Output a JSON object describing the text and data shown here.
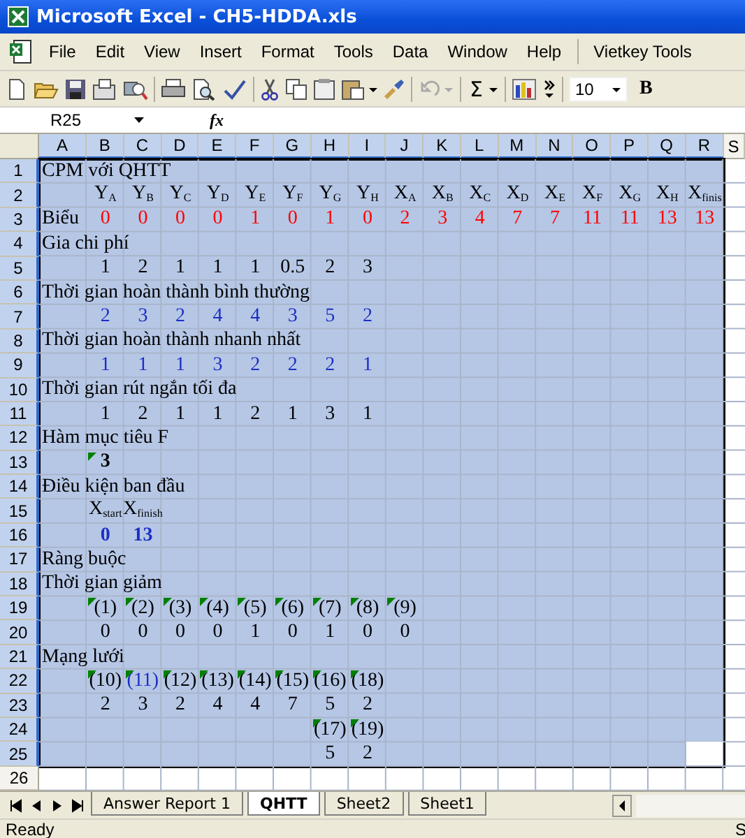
{
  "window": {
    "title": "Microsoft Excel - CH5-HDDA.xls"
  },
  "menu": [
    "File",
    "Edit",
    "View",
    "Insert",
    "Format",
    "Tools",
    "Data",
    "Window",
    "Help",
    "Vietkey Tools"
  ],
  "toolbar": {
    "sum_label": "Σ",
    "font_size": "10",
    "bold_label": "B"
  },
  "formula_bar": {
    "name_box": "R25",
    "function_label": "fx"
  },
  "sheet": {
    "columns": [
      {
        "label": "A",
        "selected": true
      },
      {
        "label": "B",
        "selected": true
      },
      {
        "label": "C",
        "selected": true
      },
      {
        "label": "D",
        "selected": true
      },
      {
        "label": "E",
        "selected": true
      },
      {
        "label": "F",
        "selected": true
      },
      {
        "label": "G",
        "selected": true
      },
      {
        "label": "H",
        "selected": true
      },
      {
        "label": "I",
        "selected": true
      },
      {
        "label": "J",
        "selected": true
      },
      {
        "label": "K",
        "selected": true
      },
      {
        "label": "L",
        "selected": true
      },
      {
        "label": "M",
        "selected": true
      },
      {
        "label": "N",
        "selected": true
      },
      {
        "label": "O",
        "selected": true
      },
      {
        "label": "P",
        "selected": true
      },
      {
        "label": "Q",
        "selected": true
      },
      {
        "label": "R",
        "selected": true
      },
      {
        "label": "S",
        "selected": false
      }
    ],
    "rows": [
      {
        "label": "1",
        "selected": true,
        "cells": [
          {
            "text": "CPM với QHTT"
          }
        ]
      },
      {
        "label": "2",
        "selected": true,
        "cells": [
          {},
          {
            "text": "Y$_{A}$"
          },
          {
            "text": "Y$_{B}$"
          },
          {
            "text": "Y$_{C}$"
          },
          {
            "text": "Y$_{D}$"
          },
          {
            "text": "Y$_{E}$"
          },
          {
            "text": "Y$_{F}$"
          },
          {
            "text": "Y$_{G}$"
          },
          {
            "text": "Y$_{H}$"
          },
          {
            "text": "X$_{A}$"
          },
          {
            "text": "X$_{B}$"
          },
          {
            "text": "X$_{C}$"
          },
          {
            "text": "X$_{D}$"
          },
          {
            "text": "X$_{E}$"
          },
          {
            "text": "X$_{F}$"
          },
          {
            "text": "X$_{G}$"
          },
          {
            "text": "X$_{H}$"
          },
          {
            "text": "X$_{finis}$"
          }
        ]
      },
      {
        "label": "3",
        "selected": true,
        "cells": [
          {
            "text": "Biểu"
          },
          {
            "text": "0",
            "color": "#ff0000"
          },
          {
            "text": "0",
            "color": "#ff0000"
          },
          {
            "text": "0",
            "color": "#ff0000"
          },
          {
            "text": "0",
            "color": "#ff0000"
          },
          {
            "text": "1",
            "color": "#ff0000"
          },
          {
            "text": "0",
            "color": "#ff0000"
          },
          {
            "text": "1",
            "color": "#ff0000"
          },
          {
            "text": "0",
            "color": "#ff0000"
          },
          {
            "text": "2",
            "color": "#ff0000"
          },
          {
            "text": "3",
            "color": "#ff0000"
          },
          {
            "text": "4",
            "color": "#ff0000"
          },
          {
            "text": "7",
            "color": "#ff0000"
          },
          {
            "text": "7",
            "color": "#ff0000"
          },
          {
            "text": "11",
            "color": "#ff0000"
          },
          {
            "text": "11",
            "color": "#ff0000"
          },
          {
            "text": "13",
            "color": "#ff0000"
          },
          {
            "text": "13",
            "color": "#ff0000"
          }
        ]
      },
      {
        "label": "4",
        "selected": true,
        "cells": [
          {
            "text": "Gia chi phí"
          }
        ]
      },
      {
        "label": "5",
        "selected": true,
        "cells": [
          {},
          {
            "text": "1"
          },
          {
            "text": "2"
          },
          {
            "text": "1"
          },
          {
            "text": "1"
          },
          {
            "text": "1"
          },
          {
            "text": "0.5"
          },
          {
            "text": "2"
          },
          {
            "text": "3"
          }
        ]
      },
      {
        "label": "6",
        "selected": true,
        "cells": [
          {
            "text": "Thời gian hoàn thành bình thường"
          }
        ]
      },
      {
        "label": "7",
        "selected": true,
        "cells": [
          {},
          {
            "text": "2",
            "color": "#1c2fc4"
          },
          {
            "text": "3",
            "color": "#1c2fc4"
          },
          {
            "text": "2",
            "color": "#1c2fc4"
          },
          {
            "text": "4",
            "color": "#1c2fc4"
          },
          {
            "text": "4",
            "color": "#1c2fc4"
          },
          {
            "text": "3",
            "color": "#1c2fc4"
          },
          {
            "text": "5",
            "color": "#1c2fc4"
          },
          {
            "text": "2",
            "color": "#1c2fc4"
          }
        ]
      },
      {
        "label": "8",
        "selected": true,
        "cells": [
          {
            "text": "Thời gian hoàn thành nhanh nhất"
          }
        ]
      },
      {
        "label": "9",
        "selected": true,
        "cells": [
          {},
          {
            "text": "1",
            "color": "#1c2fc4"
          },
          {
            "text": "1",
            "color": "#1c2fc4"
          },
          {
            "text": "1",
            "color": "#1c2fc4"
          },
          {
            "text": "3",
            "color": "#1c2fc4"
          },
          {
            "text": "2",
            "color": "#1c2fc4"
          },
          {
            "text": "2",
            "color": "#1c2fc4"
          },
          {
            "text": "2",
            "color": "#1c2fc4"
          },
          {
            "text": "1",
            "color": "#1c2fc4"
          }
        ]
      },
      {
        "label": "10",
        "selected": true,
        "cells": [
          {
            "text": "Thời gian rút ngắn tối đa"
          }
        ]
      },
      {
        "label": "11",
        "selected": true,
        "cells": [
          {},
          {
            "text": "1"
          },
          {
            "text": "2"
          },
          {
            "text": "1"
          },
          {
            "text": "1"
          },
          {
            "text": "2"
          },
          {
            "text": "1"
          },
          {
            "text": "3"
          },
          {
            "text": "1"
          }
        ]
      },
      {
        "label": "12",
        "selected": true,
        "cells": [
          {
            "text": "Hàm mục tiêu F"
          }
        ]
      },
      {
        "label": "13",
        "selected": true,
        "cells": [
          {},
          {
            "text": "3",
            "bold": true,
            "flagged": true
          }
        ]
      },
      {
        "label": "14",
        "selected": true,
        "cells": [
          {
            "text": "Điều kiện ban đầu"
          }
        ]
      },
      {
        "label": "15",
        "selected": true,
        "cells": [
          {},
          {
            "text": "X$_{start}$"
          },
          {
            "text": "X$_{finish}$"
          }
        ]
      },
      {
        "label": "16",
        "selected": true,
        "cells": [
          {},
          {
            "text": "0",
            "bold": true,
            "color": "#1c2fc4"
          },
          {
            "text": "13",
            "bold": true,
            "color": "#1c2fc4"
          }
        ]
      },
      {
        "label": "17",
        "selected": true,
        "cells": [
          {
            "text": "Ràng buộc"
          }
        ]
      },
      {
        "label": "18",
        "selected": true,
        "cells": [
          {
            "text": "Thời gian giảm"
          }
        ]
      },
      {
        "label": "19",
        "selected": true,
        "cells": [
          {},
          {
            "text": "(1)",
            "flagged": true
          },
          {
            "text": "(2)",
            "flagged": true
          },
          {
            "text": "(3)",
            "flagged": true
          },
          {
            "text": "(4)",
            "flagged": true
          },
          {
            "text": "(5)",
            "flagged": true
          },
          {
            "text": "(6)",
            "flagged": true
          },
          {
            "text": "(7)",
            "flagged": true
          },
          {
            "text": "(8)",
            "flagged": true
          },
          {
            "text": "(9)",
            "flagged": true
          }
        ]
      },
      {
        "label": "20",
        "selected": true,
        "cells": [
          {},
          {
            "text": "0"
          },
          {
            "text": "0"
          },
          {
            "text": "0"
          },
          {
            "text": "0"
          },
          {
            "text": "1"
          },
          {
            "text": "0"
          },
          {
            "text": "1"
          },
          {
            "text": "0"
          },
          {
            "text": "0"
          }
        ]
      },
      {
        "label": "21",
        "selected": true,
        "cells": [
          {
            "text": "Mạng lưới"
          }
        ]
      },
      {
        "label": "22",
        "selected": true,
        "cells": [
          {},
          {
            "text": "(10)",
            "flagged": true
          },
          {
            "text": "(11)",
            "flagged": true,
            "color": "#1c2fc4"
          },
          {
            "text": "(12)",
            "flagged": true
          },
          {
            "text": "(13)",
            "flagged": true
          },
          {
            "text": "(14)",
            "flagged": true
          },
          {
            "text": "(15)",
            "flagged": true
          },
          {
            "text": "(16)",
            "flagged": true
          },
          {
            "text": "(18)",
            "flagged": true
          }
        ]
      },
      {
        "label": "23",
        "selected": true,
        "cells": [
          {},
          {
            "text": "2"
          },
          {
            "text": "3"
          },
          {
            "text": "2"
          },
          {
            "text": "4"
          },
          {
            "text": "4"
          },
          {
            "text": "7"
          },
          {
            "text": "5"
          },
          {
            "text": "2"
          }
        ]
      },
      {
        "label": "24",
        "selected": true,
        "cells": [
          {},
          {},
          {},
          {},
          {},
          {},
          {},
          {
            "text": "(17)",
            "flagged": true
          },
          {
            "text": "(19)",
            "flagged": true
          }
        ]
      },
      {
        "label": "25",
        "selected": true,
        "cells": [
          {},
          {},
          {},
          {},
          {},
          {},
          {},
          {
            "text": "5"
          },
          {
            "text": "2"
          },
          {},
          {},
          {},
          {},
          {},
          {},
          {},
          {},
          {
            "active": true
          }
        ]
      },
      {
        "label": "26",
        "selected": false,
        "cells": []
      }
    ]
  },
  "sheet_tabs": [
    {
      "label": "Answer Report 1",
      "selected": false
    },
    {
      "label": "QHTT",
      "selected": true
    },
    {
      "label": "Sheet2",
      "selected": false
    },
    {
      "label": "Sheet1",
      "selected": false
    }
  ],
  "status_bar": {
    "status": "Ready",
    "right": "S"
  }
}
